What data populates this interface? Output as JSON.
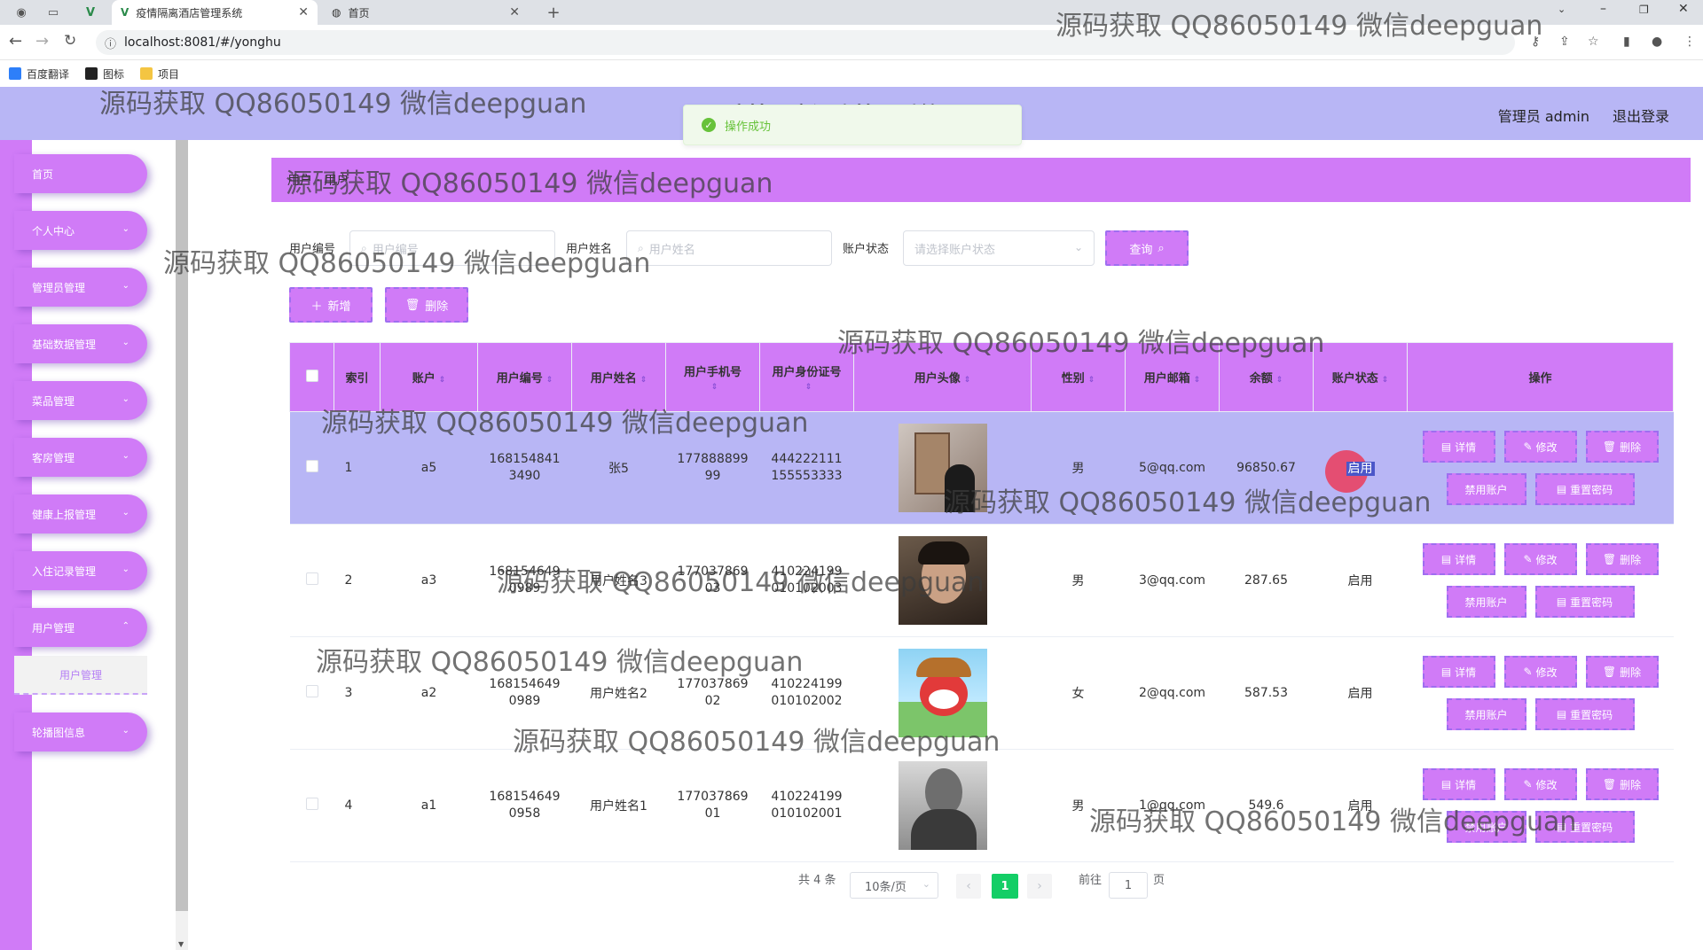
{
  "browser": {
    "tabs": [
      {
        "title": "疫情隔离酒店管理系统",
        "active": true
      },
      {
        "title": "首页",
        "active": false
      }
    ],
    "url": "localhost:8081/#/yonghu",
    "bookmarks": [
      "百度翻译",
      "图标",
      "项目"
    ],
    "new_tab": "+",
    "close": "✕"
  },
  "header": {
    "title": "疫情隔离酒店管理系统",
    "admin": "管理员 admin",
    "logout": "退出登录"
  },
  "toast": {
    "message": "操作成功"
  },
  "sidebar": {
    "items": [
      {
        "label": "首页"
      },
      {
        "label": "个人中心"
      },
      {
        "label": "管理员管理"
      },
      {
        "label": "基础数据管理"
      },
      {
        "label": "菜品管理"
      },
      {
        "label": "客房管理"
      },
      {
        "label": "健康上报管理"
      },
      {
        "label": "入住记录管理"
      },
      {
        "label": "用户管理"
      }
    ],
    "submenu": "用户管理",
    "last": {
      "label": "轮播图信息"
    }
  },
  "breadcrumb": "用户 · 用户",
  "filters": {
    "user_no_label": "用户编号",
    "user_no_placeholder": "用户编号",
    "user_name_label": "用户姓名",
    "user_name_placeholder": "用户姓名",
    "status_label": "账户状态",
    "status_placeholder": "请选择账户状态",
    "query": "查询"
  },
  "actions": {
    "add": "新增",
    "delete": "删除"
  },
  "table": {
    "headers": [
      "索引",
      "账户",
      "用户编号",
      "用户姓名",
      "用户手机号",
      "用户身份证号",
      "用户头像",
      "性别",
      "用户邮箱",
      "余额",
      "账户状态",
      "操作"
    ],
    "rows": [
      {
        "idx": "1",
        "account": "a5",
        "no": "1681548413490",
        "name": "张5",
        "phone": "17788889999",
        "idcard": "444222111155553333",
        "gender": "男",
        "email": "5@qq.com",
        "balance": "96850.67",
        "status": "启用"
      },
      {
        "idx": "2",
        "account": "a3",
        "no": "1681546490989",
        "name": "用户姓名3",
        "phone": "17703786903",
        "idcard": "410224199010102003",
        "gender": "男",
        "email": "3@qq.com",
        "balance": "287.65",
        "status": "启用"
      },
      {
        "idx": "3",
        "account": "a2",
        "no": "1681546490989",
        "name": "用户姓名2",
        "phone": "17703786902",
        "idcard": "410224199010102002",
        "gender": "女",
        "email": "2@qq.com",
        "balance": "587.53",
        "status": "启用"
      },
      {
        "idx": "4",
        "account": "a1",
        "no": "1681546490958",
        "name": "用户姓名1",
        "phone": "17703786901",
        "idcard": "410224199010102001",
        "gender": "男",
        "email": "1@qq.com",
        "balance": "549.6",
        "status": "启用"
      }
    ],
    "op_labels": {
      "detail": "详情",
      "edit": "修改",
      "delete": "删除",
      "disable": "禁用账户",
      "reset": "重置密码"
    }
  },
  "pagination": {
    "total": "共 4 条",
    "size": "10条/页",
    "current": "1",
    "goto": "前往",
    "page_input": "1",
    "page_unit": "页"
  },
  "watermark": "源码获取 QQ86050149 微信deepguan",
  "colors": {
    "primary": "#d07bf7",
    "header": "#b8b6f5",
    "success": "#13ce66"
  }
}
